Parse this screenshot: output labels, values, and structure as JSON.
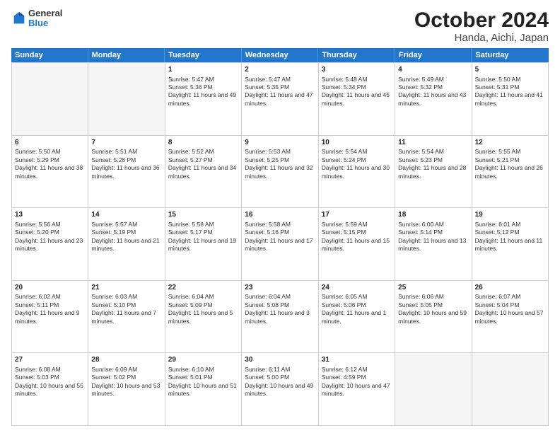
{
  "header": {
    "logo_line1": "General",
    "logo_line2": "Blue",
    "title": "October 2024",
    "subtitle": "Handa, Aichi, Japan"
  },
  "days_of_week": [
    "Sunday",
    "Monday",
    "Tuesday",
    "Wednesday",
    "Thursday",
    "Friday",
    "Saturday"
  ],
  "weeks": [
    [
      {
        "day": "",
        "sunrise": "",
        "sunset": "",
        "daylight": "",
        "empty": true
      },
      {
        "day": "",
        "sunrise": "",
        "sunset": "",
        "daylight": "",
        "empty": true
      },
      {
        "day": "1",
        "sunrise": "Sunrise: 5:47 AM",
        "sunset": "Sunset: 5:36 PM",
        "daylight": "Daylight: 11 hours and 49 minutes."
      },
      {
        "day": "2",
        "sunrise": "Sunrise: 5:47 AM",
        "sunset": "Sunset: 5:35 PM",
        "daylight": "Daylight: 11 hours and 47 minutes."
      },
      {
        "day": "3",
        "sunrise": "Sunrise: 5:48 AM",
        "sunset": "Sunset: 5:34 PM",
        "daylight": "Daylight: 11 hours and 45 minutes."
      },
      {
        "day": "4",
        "sunrise": "Sunrise: 5:49 AM",
        "sunset": "Sunset: 5:32 PM",
        "daylight": "Daylight: 11 hours and 43 minutes."
      },
      {
        "day": "5",
        "sunrise": "Sunrise: 5:50 AM",
        "sunset": "Sunset: 5:31 PM",
        "daylight": "Daylight: 11 hours and 41 minutes."
      }
    ],
    [
      {
        "day": "6",
        "sunrise": "Sunrise: 5:50 AM",
        "sunset": "Sunset: 5:29 PM",
        "daylight": "Daylight: 11 hours and 38 minutes."
      },
      {
        "day": "7",
        "sunrise": "Sunrise: 5:51 AM",
        "sunset": "Sunset: 5:28 PM",
        "daylight": "Daylight: 11 hours and 36 minutes."
      },
      {
        "day": "8",
        "sunrise": "Sunrise: 5:52 AM",
        "sunset": "Sunset: 5:27 PM",
        "daylight": "Daylight: 11 hours and 34 minutes."
      },
      {
        "day": "9",
        "sunrise": "Sunrise: 5:53 AM",
        "sunset": "Sunset: 5:25 PM",
        "daylight": "Daylight: 11 hours and 32 minutes."
      },
      {
        "day": "10",
        "sunrise": "Sunrise: 5:54 AM",
        "sunset": "Sunset: 5:24 PM",
        "daylight": "Daylight: 11 hours and 30 minutes."
      },
      {
        "day": "11",
        "sunrise": "Sunrise: 5:54 AM",
        "sunset": "Sunset: 5:23 PM",
        "daylight": "Daylight: 11 hours and 28 minutes."
      },
      {
        "day": "12",
        "sunrise": "Sunrise: 5:55 AM",
        "sunset": "Sunset: 5:21 PM",
        "daylight": "Daylight: 11 hours and 26 minutes."
      }
    ],
    [
      {
        "day": "13",
        "sunrise": "Sunrise: 5:56 AM",
        "sunset": "Sunset: 5:20 PM",
        "daylight": "Daylight: 11 hours and 23 minutes."
      },
      {
        "day": "14",
        "sunrise": "Sunrise: 5:57 AM",
        "sunset": "Sunset: 5:19 PM",
        "daylight": "Daylight: 11 hours and 21 minutes."
      },
      {
        "day": "15",
        "sunrise": "Sunrise: 5:58 AM",
        "sunset": "Sunset: 5:17 PM",
        "daylight": "Daylight: 11 hours and 19 minutes."
      },
      {
        "day": "16",
        "sunrise": "Sunrise: 5:58 AM",
        "sunset": "Sunset: 5:16 PM",
        "daylight": "Daylight: 11 hours and 17 minutes."
      },
      {
        "day": "17",
        "sunrise": "Sunrise: 5:59 AM",
        "sunset": "Sunset: 5:15 PM",
        "daylight": "Daylight: 11 hours and 15 minutes."
      },
      {
        "day": "18",
        "sunrise": "Sunrise: 6:00 AM",
        "sunset": "Sunset: 5:14 PM",
        "daylight": "Daylight: 11 hours and 13 minutes."
      },
      {
        "day": "19",
        "sunrise": "Sunrise: 6:01 AM",
        "sunset": "Sunset: 5:12 PM",
        "daylight": "Daylight: 11 hours and 11 minutes."
      }
    ],
    [
      {
        "day": "20",
        "sunrise": "Sunrise: 6:02 AM",
        "sunset": "Sunset: 5:11 PM",
        "daylight": "Daylight: 11 hours and 9 minutes."
      },
      {
        "day": "21",
        "sunrise": "Sunrise: 6:03 AM",
        "sunset": "Sunset: 5:10 PM",
        "daylight": "Daylight: 11 hours and 7 minutes."
      },
      {
        "day": "22",
        "sunrise": "Sunrise: 6:04 AM",
        "sunset": "Sunset: 5:09 PM",
        "daylight": "Daylight: 11 hours and 5 minutes."
      },
      {
        "day": "23",
        "sunrise": "Sunrise: 6:04 AM",
        "sunset": "Sunset: 5:08 PM",
        "daylight": "Daylight: 11 hours and 3 minutes."
      },
      {
        "day": "24",
        "sunrise": "Sunrise: 6:05 AM",
        "sunset": "Sunset: 5:06 PM",
        "daylight": "Daylight: 11 hours and 1 minute."
      },
      {
        "day": "25",
        "sunrise": "Sunrise: 6:06 AM",
        "sunset": "Sunset: 5:05 PM",
        "daylight": "Daylight: 10 hours and 59 minutes."
      },
      {
        "day": "26",
        "sunrise": "Sunrise: 6:07 AM",
        "sunset": "Sunset: 5:04 PM",
        "daylight": "Daylight: 10 hours and 57 minutes."
      }
    ],
    [
      {
        "day": "27",
        "sunrise": "Sunrise: 6:08 AM",
        "sunset": "Sunset: 5:03 PM",
        "daylight": "Daylight: 10 hours and 55 minutes."
      },
      {
        "day": "28",
        "sunrise": "Sunrise: 6:09 AM",
        "sunset": "Sunset: 5:02 PM",
        "daylight": "Daylight: 10 hours and 53 minutes."
      },
      {
        "day": "29",
        "sunrise": "Sunrise: 6:10 AM",
        "sunset": "Sunset: 5:01 PM",
        "daylight": "Daylight: 10 hours and 51 minutes."
      },
      {
        "day": "30",
        "sunrise": "Sunrise: 6:11 AM",
        "sunset": "Sunset: 5:00 PM",
        "daylight": "Daylight: 10 hours and 49 minutes."
      },
      {
        "day": "31",
        "sunrise": "Sunrise: 6:12 AM",
        "sunset": "Sunset: 4:59 PM",
        "daylight": "Daylight: 10 hours and 47 minutes."
      },
      {
        "day": "",
        "sunrise": "",
        "sunset": "",
        "daylight": "",
        "empty": true
      },
      {
        "day": "",
        "sunrise": "",
        "sunset": "",
        "daylight": "",
        "empty": true
      }
    ]
  ]
}
